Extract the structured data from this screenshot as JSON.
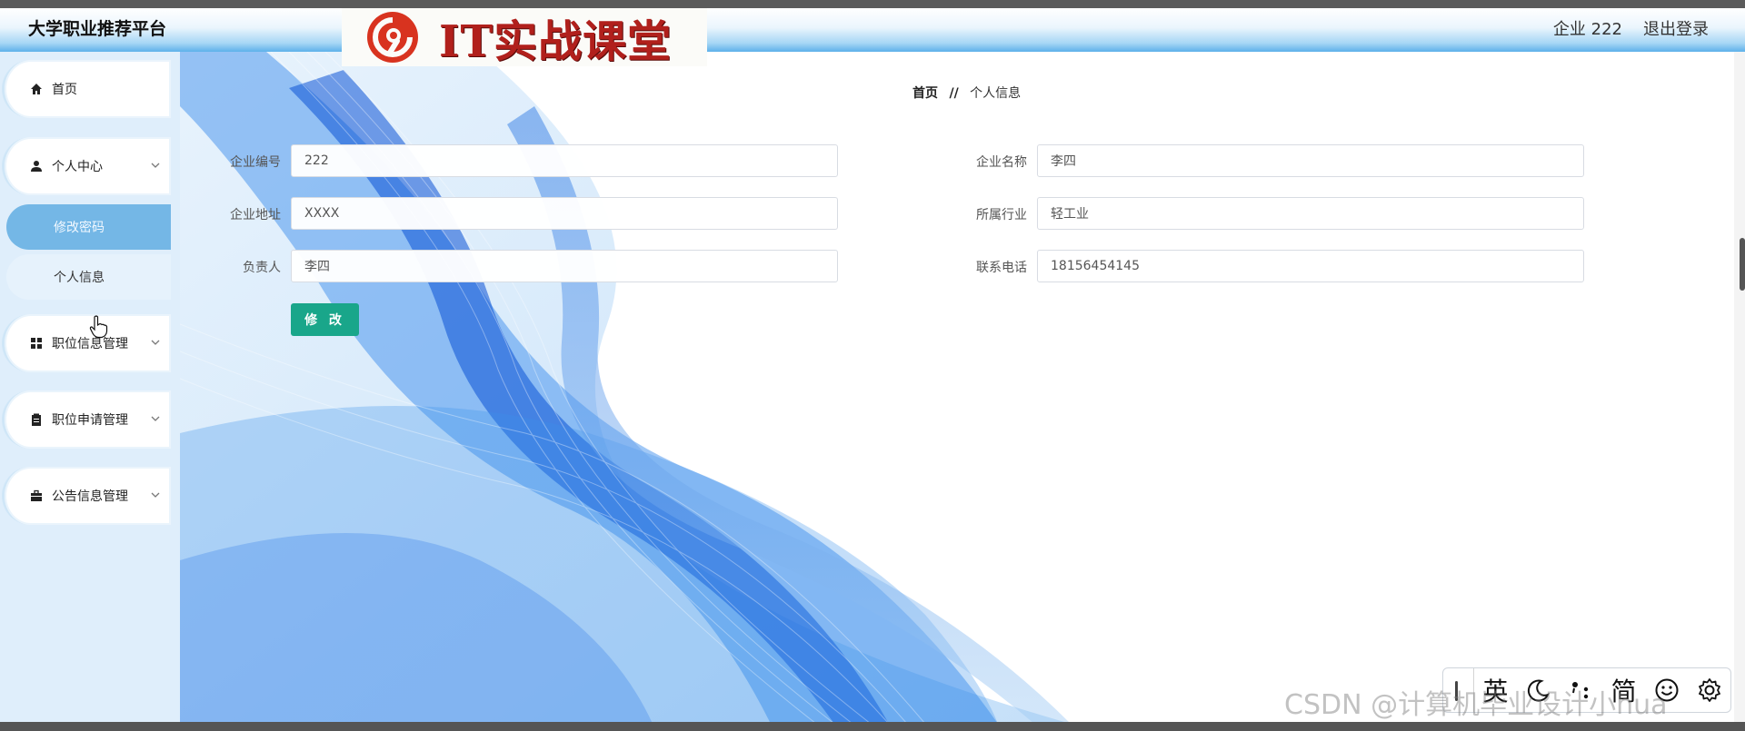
{
  "header": {
    "brand": "大学职业推荐平台",
    "user_label": "企业 222",
    "logout_label": "退出登录"
  },
  "banner": {
    "text": "IT实战课堂"
  },
  "sidebar": {
    "items": [
      {
        "label": "首页",
        "icon": "home-icon"
      },
      {
        "label": "个人中心",
        "icon": "user-icon",
        "expanded": true,
        "children": [
          {
            "label": "修改密码",
            "active": true
          },
          {
            "label": "个人信息",
            "active": false
          }
        ]
      },
      {
        "label": "职位信息管理",
        "icon": "grid-icon"
      },
      {
        "label": "职位申请管理",
        "icon": "clipboard-icon"
      },
      {
        "label": "公告信息管理",
        "icon": "briefcase-icon"
      }
    ]
  },
  "breadcrumb": {
    "home": "首页",
    "separator": "//",
    "current": "个人信息"
  },
  "form": {
    "fields": [
      {
        "label": "企业编号",
        "value": "222"
      },
      {
        "label": "企业名称",
        "value": "李四"
      },
      {
        "label": "企业地址",
        "value": "XXXX"
      },
      {
        "label": "所属行业",
        "value": "轻工业"
      },
      {
        "label": "负责人",
        "value": "李四"
      },
      {
        "label": "联系电话",
        "value": "18156454145"
      }
    ],
    "submit_label": "修 改"
  },
  "ime": {
    "buttons": [
      "英",
      "简"
    ]
  },
  "watermark": "CSDN @计算机毕业设计小hua",
  "colors": {
    "accent": "#19a68a",
    "active_sub": "#74b7e6",
    "header_blue": "#5db1ea"
  }
}
